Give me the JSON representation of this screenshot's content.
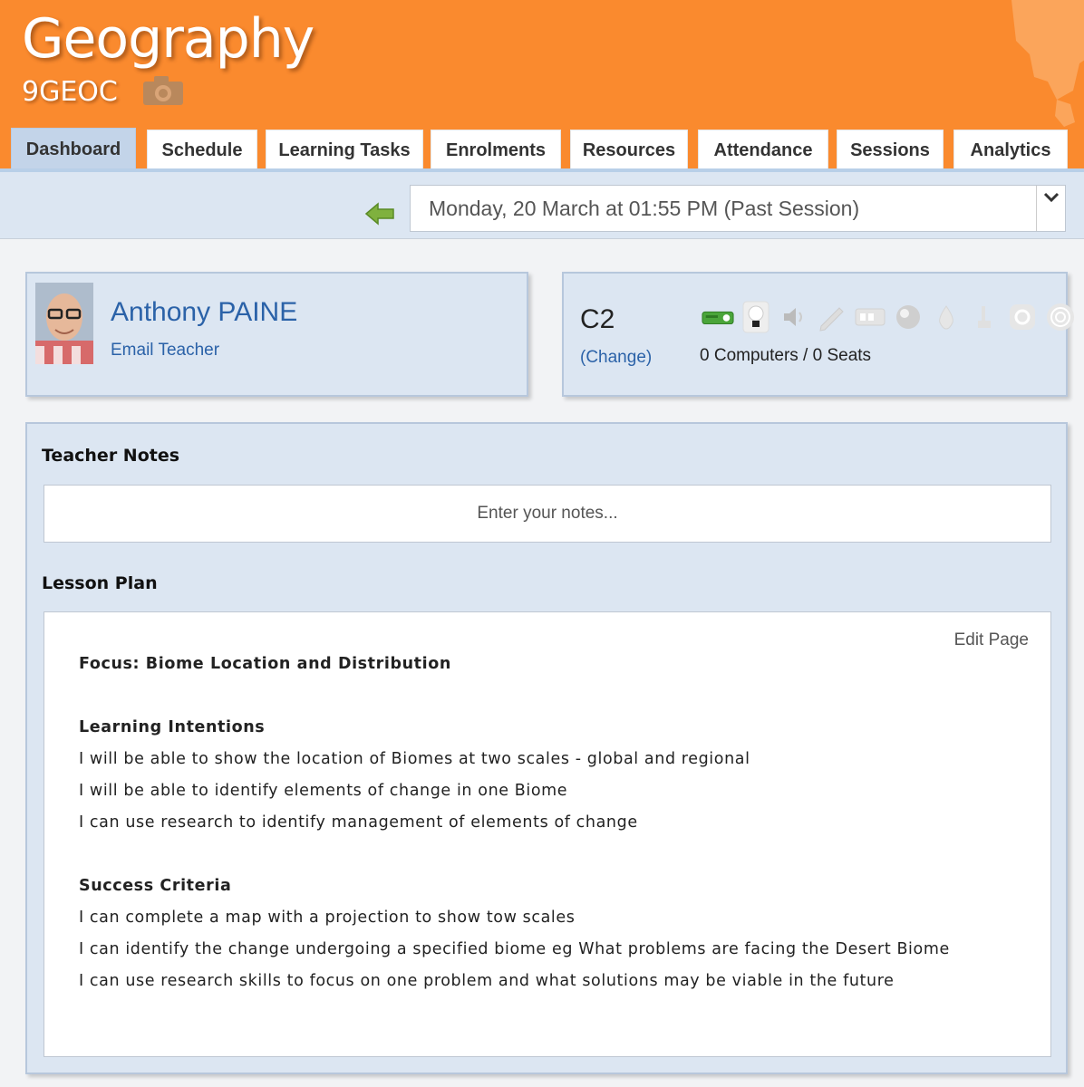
{
  "header": {
    "title": "Geography",
    "class_code": "9GEOC",
    "bg_color": "#fa8a2e"
  },
  "tabs": [
    {
      "label": "Dashboard",
      "active": true
    },
    {
      "label": "Schedule",
      "active": false
    },
    {
      "label": "Learning Tasks",
      "active": false
    },
    {
      "label": "Enrolments",
      "active": false
    },
    {
      "label": "Resources",
      "active": false
    },
    {
      "label": "Attendance",
      "active": false
    },
    {
      "label": "Sessions",
      "active": false
    },
    {
      "label": "Analytics",
      "active": false
    }
  ],
  "session": {
    "selected": "Monday, 20 March at 01:55 PM (Past Session)"
  },
  "teacher": {
    "name": "Anthony PAINE",
    "email_link": "Email Teacher"
  },
  "room": {
    "name": "C2",
    "change_link": "(Change)",
    "stats": "0 Computers / 0 Seats",
    "facility_icons": [
      "projector-icon",
      "lightbulb-icon",
      "speaker-icon",
      "pen-icon",
      "keyboard-icon",
      "disc-icon",
      "water-drop-icon",
      "tap-icon",
      "settings-icon",
      "target-icon"
    ]
  },
  "notes": {
    "label": "Teacher Notes",
    "placeholder": "Enter your notes..."
  },
  "lesson_plan": {
    "label": "Lesson Plan",
    "edit_link": "Edit Page",
    "focus": "Focus: Biome Location and Distribution",
    "intentions_heading": "Learning Intentions",
    "intentions": [
      "I will be able to show the location of Biomes at two scales - global and regional",
      "I will be able to identify elements of change in one Biome",
      "I can use research to identify management of elements of change"
    ],
    "criteria_heading": "Success Criteria",
    "criteria": [
      "I can complete a map with a projection to show tow scales",
      "I can identify the change undergoing a specified biome eg What problems are facing the Desert Biome",
      "I can use research skills to focus on one problem and what solutions may be viable in the future"
    ]
  }
}
